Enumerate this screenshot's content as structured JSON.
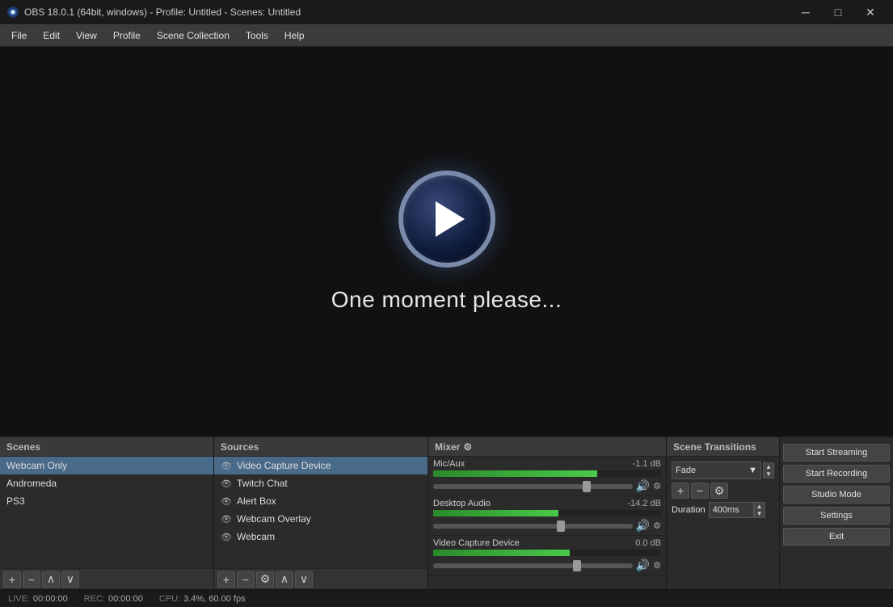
{
  "titlebar": {
    "title": "OBS 18.0.1 (64bit, windows) - Profile: Untitled - Scenes: Untitled",
    "min_label": "─",
    "max_label": "□",
    "close_label": "✕"
  },
  "menu": {
    "items": [
      "File",
      "Edit",
      "View",
      "Profile",
      "Scene Collection",
      "Tools",
      "Help"
    ]
  },
  "preview": {
    "loading_text": "One moment please..."
  },
  "scenes": {
    "header": "Scenes",
    "items": [
      "Webcam Only",
      "Andromeda",
      "PS3"
    ],
    "selected_index": 0
  },
  "sources": {
    "header": "Sources",
    "items": [
      {
        "name": "Video Capture Device",
        "selected": true
      },
      {
        "name": "Twitch Chat",
        "selected": false
      },
      {
        "name": "Alert Box",
        "selected": false
      },
      {
        "name": "Webcam Overlay",
        "selected": false
      },
      {
        "name": "Webcam",
        "selected": false
      }
    ]
  },
  "mixer": {
    "header": "Mixer",
    "tracks": [
      {
        "name": "Mic/Aux",
        "db": "-1.1 dB",
        "fill_pct": 72,
        "slider_pct": 78
      },
      {
        "name": "Desktop Audio",
        "db": "-14.2 dB",
        "fill_pct": 55,
        "slider_pct": 65
      },
      {
        "name": "Video Capture Device",
        "db": "0.0 dB",
        "fill_pct": 60,
        "slider_pct": 72
      }
    ]
  },
  "transitions": {
    "header": "Scene Transitions",
    "type": "Fade",
    "duration_label": "Duration",
    "duration_value": "400ms"
  },
  "controls": {
    "start_streaming": "Start Streaming",
    "start_recording": "Start Recording",
    "studio_mode": "Studio Mode",
    "settings": "Settings",
    "exit": "Exit"
  },
  "statusbar": {
    "live_label": "LIVE:",
    "live_value": "00:00:00",
    "rec_label": "REC:",
    "rec_value": "00:00:00",
    "cpu_label": "CPU:",
    "cpu_value": "3.4%, 60.00 fps"
  }
}
